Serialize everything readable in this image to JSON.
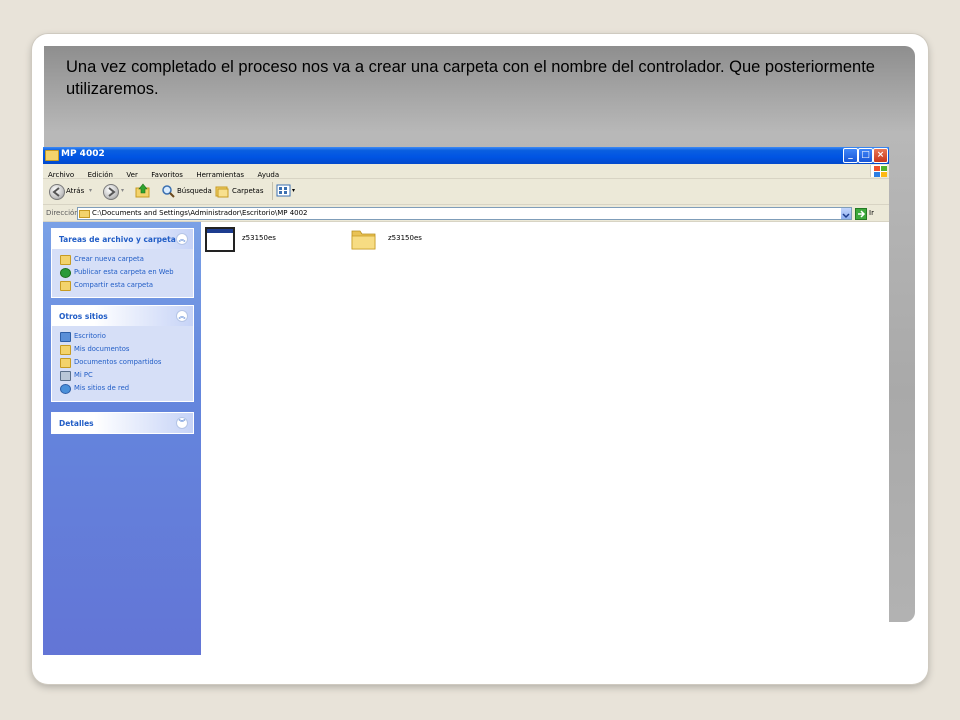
{
  "slide": {
    "caption": "Una vez completado el proceso nos va a crear una carpeta con el nombre del controlador. Que posteriormente utilizaremos."
  },
  "window": {
    "title": "MP 4002",
    "controls": {
      "minimize": "_",
      "maximize": "□",
      "close": "×"
    }
  },
  "menubar": {
    "items": [
      "Archivo",
      "Edición",
      "Ver",
      "Favoritos",
      "Herramientas",
      "Ayuda"
    ]
  },
  "toolbar": {
    "back_label": "Atrás",
    "search_label": "Búsqueda",
    "folders_label": "Carpetas"
  },
  "address": {
    "label": "Dirección",
    "value": "C:\\Documents and Settings\\Administrador\\Escritorio\\MP 4002",
    "go_label": "Ir"
  },
  "sidebar": {
    "file_tasks": {
      "title": "Tareas de archivo y carpeta",
      "items": [
        "Crear nueva carpeta",
        "Publicar esta carpeta en Web",
        "Compartir esta carpeta"
      ]
    },
    "other_places": {
      "title": "Otros sitios",
      "items": [
        "Escritorio",
        "Mis documentos",
        "Documentos compartidos",
        "Mi PC",
        "Mis sitios de red"
      ]
    },
    "details": {
      "title": "Detalles"
    }
  },
  "files": [
    {
      "name": "z53150es",
      "type": "application",
      "icon": "window-app-icon"
    },
    {
      "name": "z53150es",
      "type": "folder",
      "icon": "folder-icon"
    }
  ],
  "colors": {
    "titlebar": "#0054e3",
    "sidebar": "#6d8fe0",
    "link": "#215dc6"
  }
}
